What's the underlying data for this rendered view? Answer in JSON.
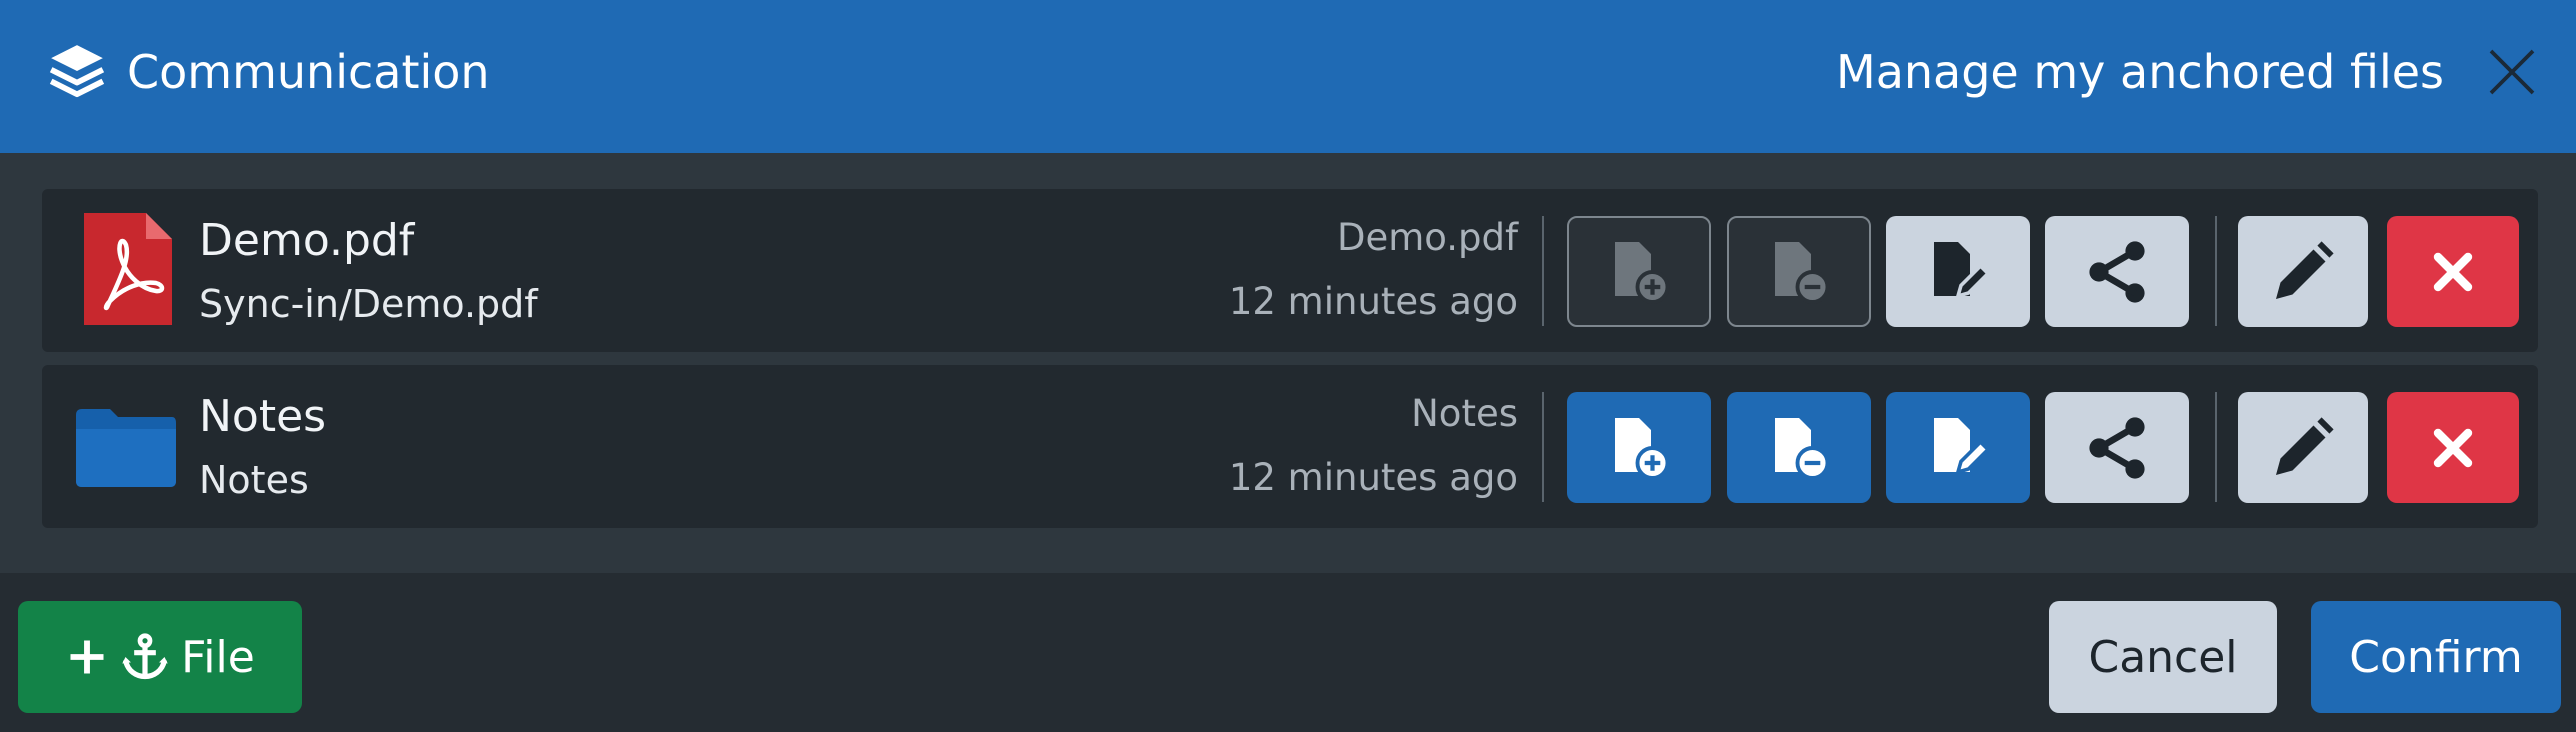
{
  "header": {
    "title": "Communication",
    "subtitle": "Manage my anchored files",
    "title_icon": "layers-icon",
    "close_icon": "close-icon"
  },
  "files": [
    {
      "name": "Demo.pdf",
      "path": "Sync-in/Demo.pdf",
      "meta_name": "Demo.pdf",
      "meta_time": "12 minutes ago",
      "icon": "pdf-file-icon",
      "permissions": {
        "add": false,
        "remove": false,
        "modify": true
      }
    },
    {
      "name": "Notes",
      "path": "Notes",
      "meta_name": "Notes",
      "meta_time": "12 minutes ago",
      "icon": "folder-icon",
      "permissions": {
        "add": true,
        "remove": true,
        "modify": true
      }
    }
  ],
  "footer": {
    "add_file_label": "File",
    "cancel_label": "Cancel",
    "confirm_label": "Confirm"
  },
  "colors": {
    "header_blue": "#1f6ab4",
    "active_blue": "#1f6ab4",
    "delete_red": "#df3646",
    "add_green": "#138348",
    "light_button": "#cbd4df"
  }
}
